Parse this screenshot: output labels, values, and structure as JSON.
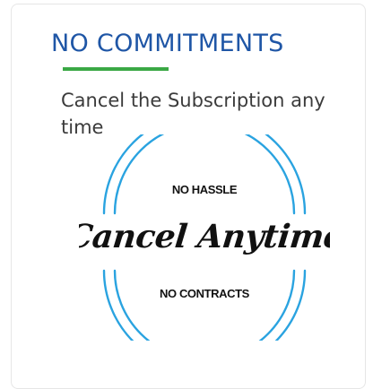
{
  "card": {
    "title": "NO COMMITMENTS",
    "subtitle": "Cancel the Subscription any time",
    "colors": {
      "title": "#1f56a6",
      "underline": "#3aa845",
      "ring": "#2aa3e0",
      "text": "#3b3b3b"
    },
    "badge": {
      "top_text": "NO HASSLE",
      "main_text": "Cancel Anytime",
      "bottom_text": "NO CONTRACTS"
    }
  }
}
